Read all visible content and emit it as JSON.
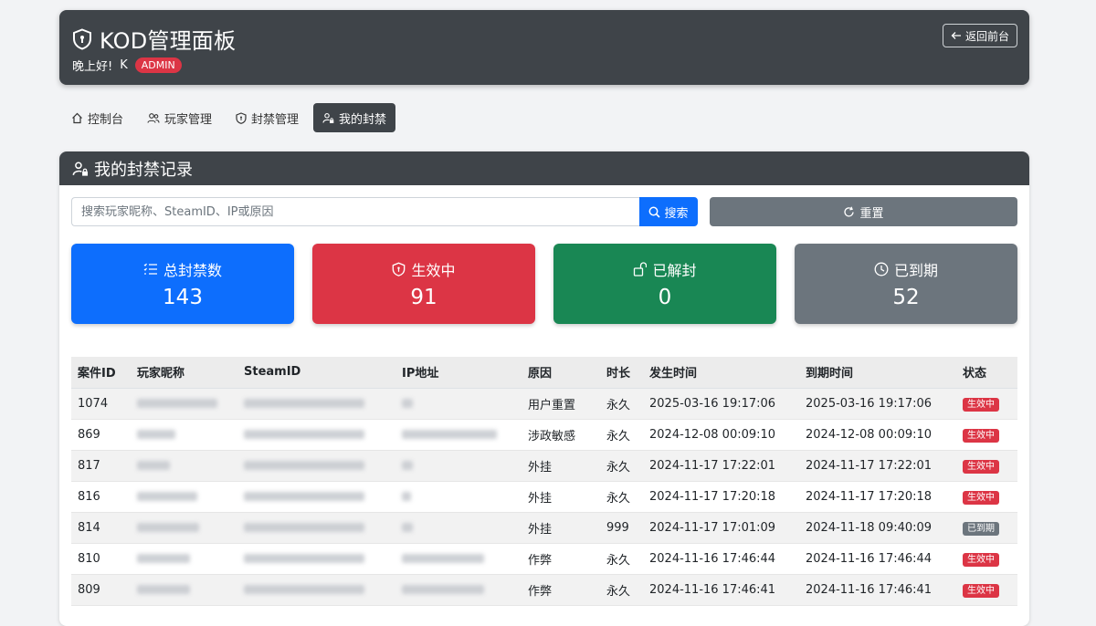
{
  "header": {
    "title": "KOD管理面板",
    "greeting": "晚上好!",
    "username": "K",
    "role_badge": "ADMIN",
    "back_label": "返回前台"
  },
  "tabs": [
    {
      "label": "控制台",
      "icon": "house-icon",
      "active": false
    },
    {
      "label": "玩家管理",
      "icon": "users-icon",
      "active": false
    },
    {
      "label": "封禁管理",
      "icon": "shield-icon",
      "active": false
    },
    {
      "label": "我的封禁",
      "icon": "user-lock-icon",
      "active": true
    }
  ],
  "card": {
    "title": "我的封禁记录"
  },
  "search": {
    "placeholder": "搜索玩家昵称、SteamID、IP或原因",
    "button_label": "搜索",
    "reset_label": "重置"
  },
  "stats": [
    {
      "label": "总封禁数",
      "value": "143",
      "color": "#0d6efd",
      "icon": "list-icon"
    },
    {
      "label": "生效中",
      "value": "91",
      "color": "#dc3545",
      "icon": "shield-icon"
    },
    {
      "label": "已解封",
      "value": "0",
      "color": "#198754",
      "icon": "unlock-icon"
    },
    {
      "label": "已到期",
      "value": "52",
      "color": "#6c757d",
      "icon": "clock-icon"
    }
  ],
  "table": {
    "columns": [
      "案件ID",
      "玩家昵称",
      "SteamID",
      "IP地址",
      "原因",
      "时长",
      "发生时间",
      "到期时间",
      "状态"
    ],
    "rows": [
      {
        "id": "1074",
        "reason": "用户重置",
        "duration": "永久",
        "time": "2025-03-16 19:17:06",
        "expire": "2025-03-16 19:17:06",
        "status": "生效中",
        "status_type": "active"
      },
      {
        "id": "869",
        "reason": "涉政敏感",
        "duration": "永久",
        "time": "2024-12-08 00:09:10",
        "expire": "2024-12-08 00:09:10",
        "status": "生效中",
        "status_type": "active"
      },
      {
        "id": "817",
        "reason": "外挂",
        "duration": "永久",
        "time": "2024-11-17 17:22:01",
        "expire": "2024-11-17 17:22:01",
        "status": "生效中",
        "status_type": "active"
      },
      {
        "id": "816",
        "reason": "外挂",
        "duration": "永久",
        "time": "2024-11-17 17:20:18",
        "expire": "2024-11-17 17:20:18",
        "status": "生效中",
        "status_type": "active"
      },
      {
        "id": "814",
        "reason": "外挂",
        "duration": "999",
        "time": "2024-11-17 17:01:09",
        "expire": "2024-11-18 09:40:09",
        "status": "已到期",
        "status_type": "expired"
      },
      {
        "id": "810",
        "reason": "作弊",
        "duration": "永久",
        "time": "2024-11-16 17:46:44",
        "expire": "2024-11-16 17:46:44",
        "status": "生效中",
        "status_type": "active"
      },
      {
        "id": "809",
        "reason": "作弊",
        "duration": "永久",
        "time": "2024-11-16 17:46:41",
        "expire": "2024-11-16 17:46:41",
        "status": "生效中",
        "status_type": "active"
      }
    ]
  },
  "colors": {
    "dark_header": "#3f4449",
    "primary": "#0d6efd",
    "danger": "#dc3545",
    "success": "#198754",
    "secondary": "#6c757d"
  }
}
